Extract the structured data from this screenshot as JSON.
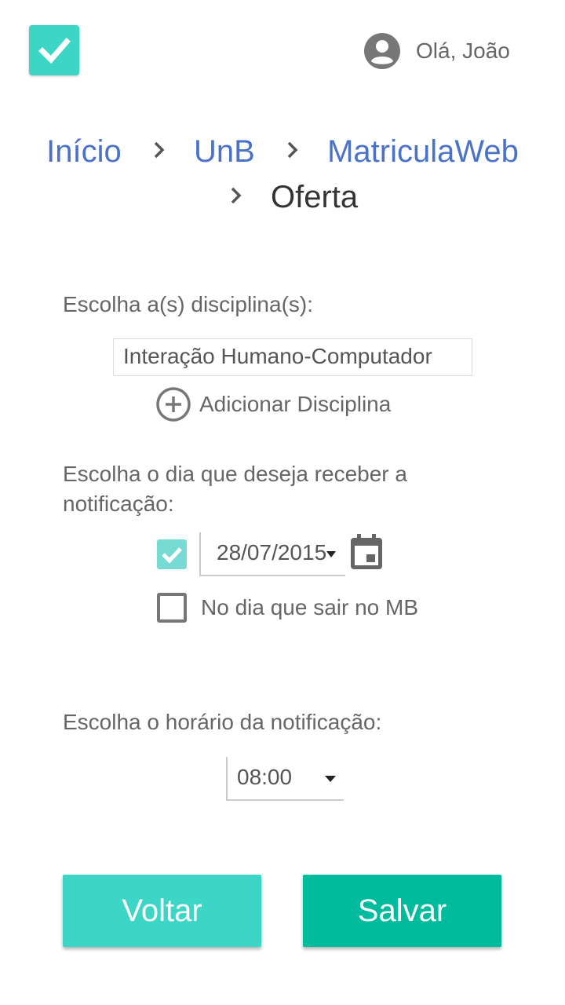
{
  "header": {
    "logo_icon": "check-icon",
    "greeting": "Olá, João",
    "avatar_icon": "account-circle-icon"
  },
  "breadcrumb": {
    "items": [
      "Início",
      "UnB",
      "MatriculaWeb"
    ],
    "current": "Oferta",
    "separator_icon": "chevron-right-icon"
  },
  "form": {
    "subjects_label": "Escolha a(s) disciplina(s):",
    "subject_value": "Interação Humano-Computador",
    "add_subject_label": "Adicionar Disciplina",
    "day_label": "Escolha o dia que deseja receber a notificação:",
    "date_checked": true,
    "date_value": "28/07/2015",
    "mb_checked": false,
    "mb_label": "No dia que sair no MB",
    "time_label": "Escolha o horário da notificação:",
    "time_value": "08:00"
  },
  "actions": {
    "back_label": "Voltar",
    "save_label": "Salvar"
  },
  "colors": {
    "accent": "#3dd6c6",
    "primary": "#00bb9c",
    "link": "#4a72c8",
    "checkbox_checked": "#78dbd3"
  }
}
